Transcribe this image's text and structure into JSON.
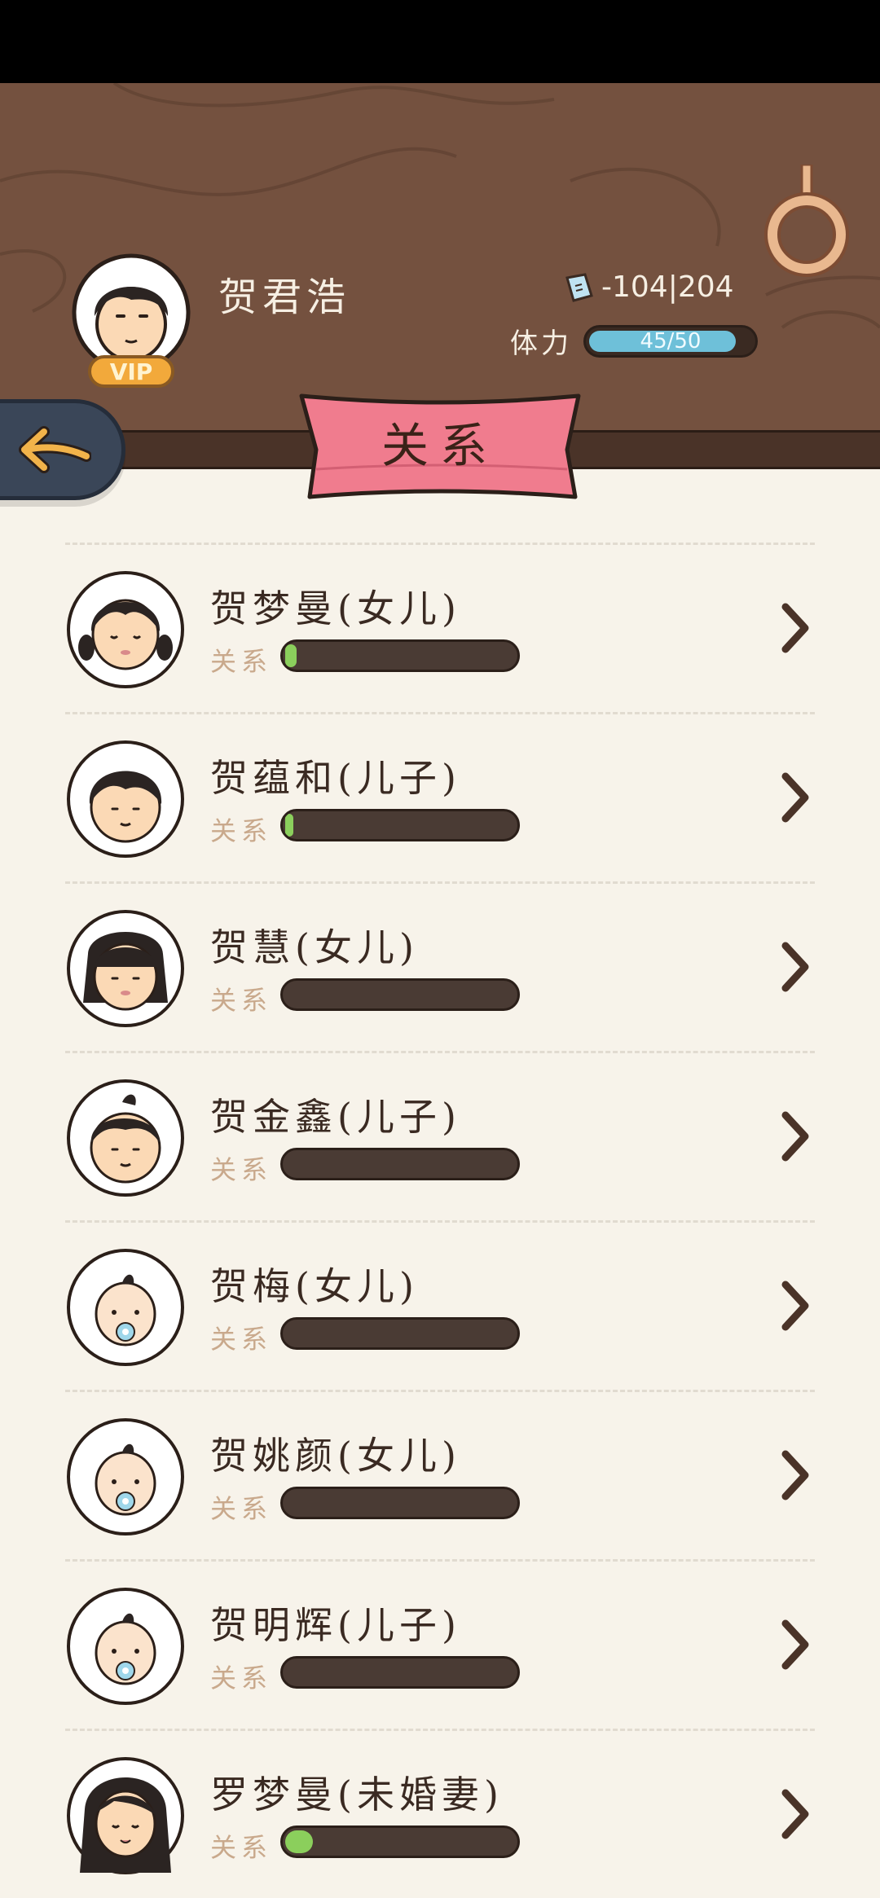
{
  "player": {
    "name": "贺君浩",
    "vip_label": "VIP",
    "money": "-104|204",
    "stamina_label": "体力",
    "stamina_text": "45/50",
    "stamina_value": 45,
    "stamina_max": 50
  },
  "page": {
    "title": "关系"
  },
  "colors": {
    "header": "#74513f",
    "accent_pink": "#f07c8e",
    "bar_green": "#8bcf5c",
    "stamina_blue": "#6ec0d9"
  },
  "relationships": [
    {
      "name": "贺梦曼(女儿)",
      "label": "关系",
      "level": 0.05,
      "avatar": "girl-pigtails-icon"
    },
    {
      "name": "贺蕴和(儿子)",
      "label": "关系",
      "level": 0.02,
      "avatar": "boy-icon"
    },
    {
      "name": "贺慧(女儿)",
      "label": "关系",
      "level": 0.0,
      "avatar": "girl-bangs-icon"
    },
    {
      "name": "贺金鑫(儿子)",
      "label": "关系",
      "level": 0.0,
      "avatar": "boy-tuft-icon"
    },
    {
      "name": "贺梅(女儿)",
      "label": "关系",
      "level": 0.0,
      "avatar": "baby-icon"
    },
    {
      "name": "贺姚颜(女儿)",
      "label": "关系",
      "level": 0.0,
      "avatar": "baby-icon"
    },
    {
      "name": "贺明辉(儿子)",
      "label": "关系",
      "level": 0.0,
      "avatar": "baby-icon"
    },
    {
      "name": "罗梦曼(未婚妻)",
      "label": "关系",
      "level": 0.12,
      "avatar": "woman-long-hair-icon"
    }
  ]
}
